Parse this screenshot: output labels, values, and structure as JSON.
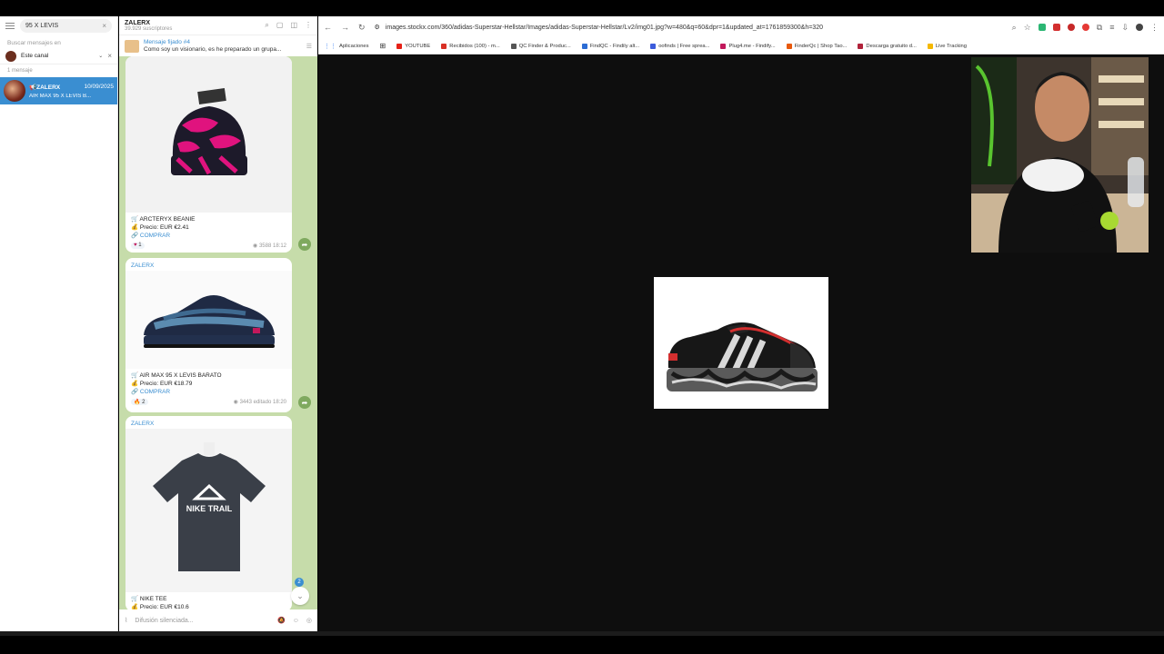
{
  "telegram": {
    "search": {
      "query": "95 X LEVIS"
    },
    "search_hint": "Buscar mensajes en",
    "filter": {
      "label": "Este canal"
    },
    "result_count": "1 mensaje",
    "chat": {
      "name": "ZALERX",
      "date": "10/09/2025",
      "preview": "AIR MAX 95 X LEVIS B..."
    },
    "channel": {
      "title": "ZALERX",
      "subscribers": "39.929 suscriptores"
    },
    "pinned": {
      "title": "Mensaje fijado #4",
      "text": "Como soy un visionario, es he preparado un grupa..."
    },
    "messages": [
      {
        "author": "",
        "item": "ARCTERYX BEANIE",
        "price": "Precio: EUR €2.41",
        "link": "COMPRAR",
        "reaction": "1",
        "views": "3588",
        "time": "18:12",
        "accent": "#e0137e"
      },
      {
        "author": "ZALERX",
        "item": "AIR MAX 95 X LEVIS BARATO",
        "price": "Precio: EUR €18.79",
        "link": "COMPRAR",
        "reaction": "2",
        "views": "3443",
        "time": "editado 18:20"
      },
      {
        "author": "ZALERX",
        "item": "NIKE TEE",
        "price": "Precio: EUR €10.6",
        "shirt_print": "NIKE TRAIL"
      }
    ],
    "unread_badge": "2",
    "compose_placeholder": "Difusión silenciada..."
  },
  "browser": {
    "url": "images.stockx.com/360/adidas-Superstar-Hellstar/Images/adidas-Superstar-Hellstar/Lv2/img01.jpg?w=480&q=60&dpr=1&updated_at=1761859300&h=320",
    "bookmarks": [
      {
        "label": "Aplicaciones",
        "color": "#4285f4"
      },
      {
        "label": "YOUTUBE",
        "color": "#e62117"
      },
      {
        "label": "Recibidos (100) - m...",
        "color": "#d93025"
      },
      {
        "label": "QC Finder & Produc...",
        "color": "#555555"
      },
      {
        "label": "FindQC - Findily alt...",
        "color": "#2b6cd4"
      },
      {
        "label": "oofinds | Free sprea...",
        "color": "#3b5bdb"
      },
      {
        "label": "Plug4.me - Findify...",
        "color": "#c2185b"
      },
      {
        "label": "FinderQc | Shop Tao...",
        "color": "#e8590c"
      },
      {
        "label": "Descarga gratuito d...",
        "color": "#b0223a"
      },
      {
        "label": "Live Tracking",
        "color": "#f5b800"
      }
    ],
    "extension_colors": [
      "#2bb673",
      "#d32f2f",
      "#c62828",
      "#e53935",
      "#777777",
      "#777777",
      "#555555"
    ]
  }
}
